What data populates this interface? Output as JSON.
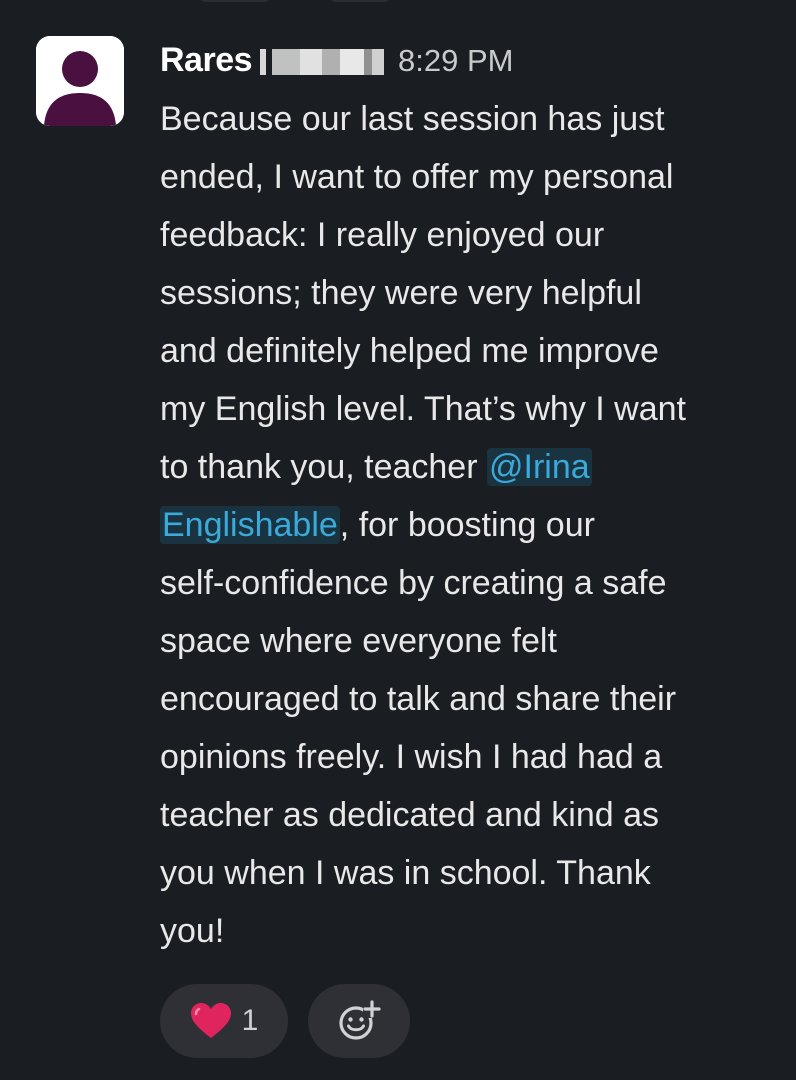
{
  "message": {
    "author": "Rares",
    "time": "8:29 PM",
    "lines": [
      "Because our last session has just",
      "ended, I want to offer my personal",
      "feedback: I really enjoyed our",
      "sessions; they were very helpful",
      "and definitely helped me improve",
      "my English level. That’s why I want"
    ],
    "line7_before": "to thank you, teacher ",
    "mention_part1": "@Irina",
    "mention_part2": "Englishable",
    "line8_after": ", for boosting our",
    "lines_after": [
      "self-confidence by creating a safe",
      "space where everyone felt",
      "encouraged to talk and share their",
      "opinions freely. I wish I had had a",
      "teacher as dedicated and kind as",
      "you when I was in school. Thank",
      "you!"
    ]
  },
  "reactions": [
    {
      "emoji": "heart-icon",
      "count": "1"
    },
    {
      "emoji": "add-reaction-icon"
    }
  ],
  "colors": {
    "background": "#1a1d21",
    "mention": "#3ba9d9",
    "avatar": "#4a1040",
    "heart": "#e0245e"
  }
}
